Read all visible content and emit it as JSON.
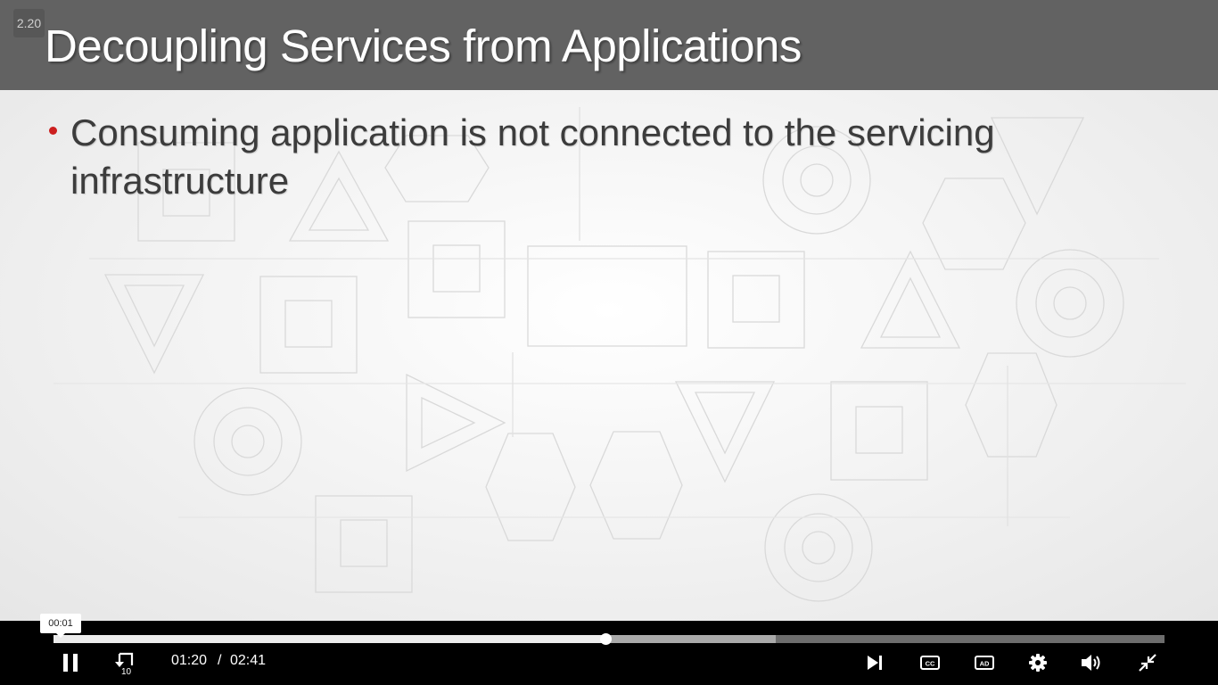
{
  "slide": {
    "badge": "2.20",
    "title": "Decoupling Services from Applications",
    "bullets": [
      "Consuming application is not connected to the servicing infrastructure"
    ],
    "colors": {
      "title_bar": "#626262",
      "bullet": "#cc1f1f",
      "text": "#3c3c3c"
    }
  },
  "player": {
    "tooltip_time": "00:01",
    "current_time": "01:20",
    "separator": "/",
    "duration": "02:41",
    "played_fraction": 0.497,
    "buffered_fraction": 0.65,
    "replay_seconds": "10",
    "icons": {
      "play_pause": "pause-icon",
      "replay": "replay-10-icon",
      "next": "skip-next-icon",
      "captions": "closed-captions-icon",
      "audio_description": "audio-description-icon",
      "settings": "gear-icon",
      "volume": "volume-icon",
      "fullscreen": "exit-fullscreen-icon"
    },
    "labels": {
      "captions": "CC",
      "audio_description": "AD"
    }
  }
}
